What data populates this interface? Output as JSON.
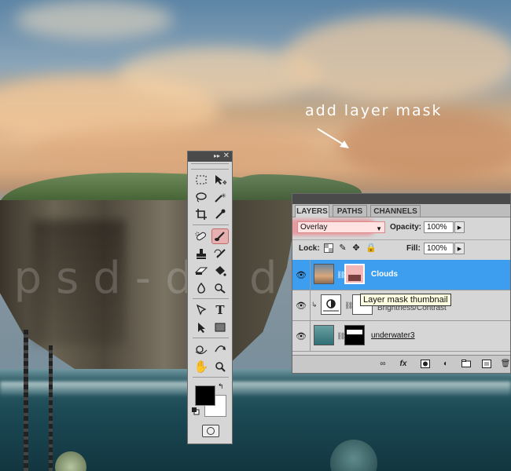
{
  "annotation": {
    "text": "add layer mask"
  },
  "watermark": {
    "text": "psd-dude.com"
  },
  "tools_panel": {
    "collapse_icon": "double-arrow-icon",
    "close_icon": "close-icon",
    "tools": [
      "marquee-tool-icon",
      "move-tool-icon",
      "lasso-tool-icon",
      "magic-wand-icon",
      "crop-tool-icon",
      "eyedropper-icon",
      "spot-healing-icon",
      "brush-tool-icon",
      "clone-stamp-icon",
      "history-brush-icon",
      "eraser-icon",
      "paint-bucket-icon",
      "blur-tool-icon",
      "dodge-tool-icon",
      "pen-tool-icon",
      "type-tool-icon",
      "path-selection-icon",
      "rectangle-tool-icon",
      "3d-rotate-icon",
      "3d-orbit-icon",
      "hand-tool-icon",
      "zoom-tool-icon"
    ],
    "selected_tool": "brush-tool-icon",
    "foreground_color": "#000000",
    "background_color": "#ffffff"
  },
  "layers_panel": {
    "tabs": [
      "LAYERS",
      "PATHS",
      "CHANNELS"
    ],
    "active_tab": "LAYERS",
    "blend_mode": "Overlay",
    "opacity_label": "Opacity:",
    "opacity_value": "100%",
    "lock_label": "Lock:",
    "fill_label": "Fill:",
    "fill_value": "100%",
    "layers": [
      {
        "name": "Clouds",
        "selected": true
      },
      {
        "name": "Brightness/Contrast",
        "selected": false
      },
      {
        "name": "underwater3",
        "selected": false
      }
    ],
    "tooltip": "Layer mask thumbnail",
    "footer_icons": [
      "link-layers-icon",
      "fx-icon",
      "add-mask-icon",
      "adjustment-layer-icon",
      "group-folder-icon",
      "new-layer-icon",
      "delete-layer-icon"
    ]
  }
}
